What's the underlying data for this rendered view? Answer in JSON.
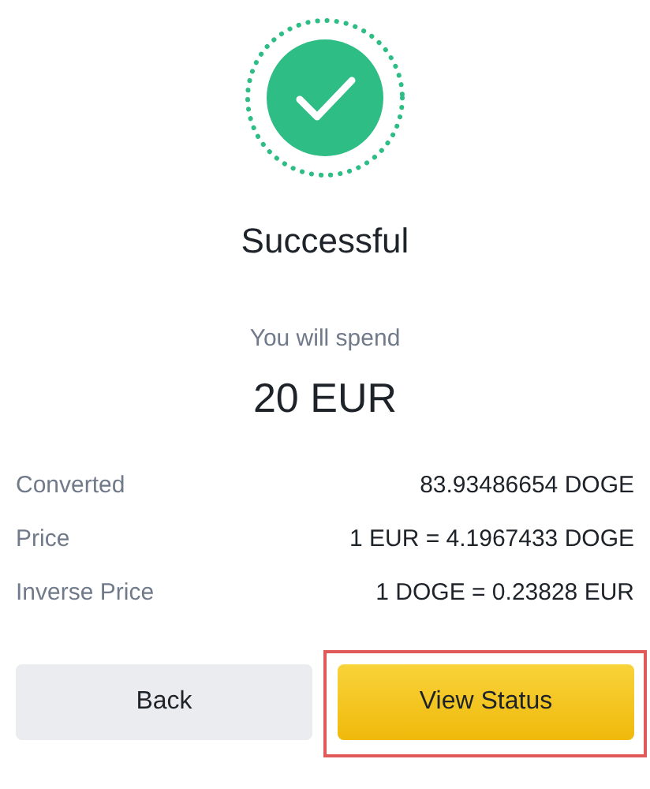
{
  "status": {
    "title": "Successful"
  },
  "spend": {
    "label": "You will spend",
    "amount": "20 EUR"
  },
  "details": [
    {
      "label": "Converted",
      "value": "83.93486654 DOGE"
    },
    {
      "label": "Price",
      "value": "1 EUR = 4.1967433 DOGE"
    },
    {
      "label": "Inverse Price",
      "value": "1 DOGE = 0.23828 EUR"
    }
  ],
  "buttons": [
    {
      "label": "Back",
      "kind": "secondary",
      "highlighted": false
    },
    {
      "label": "View Status",
      "kind": "primary",
      "highlighted": true
    }
  ]
}
